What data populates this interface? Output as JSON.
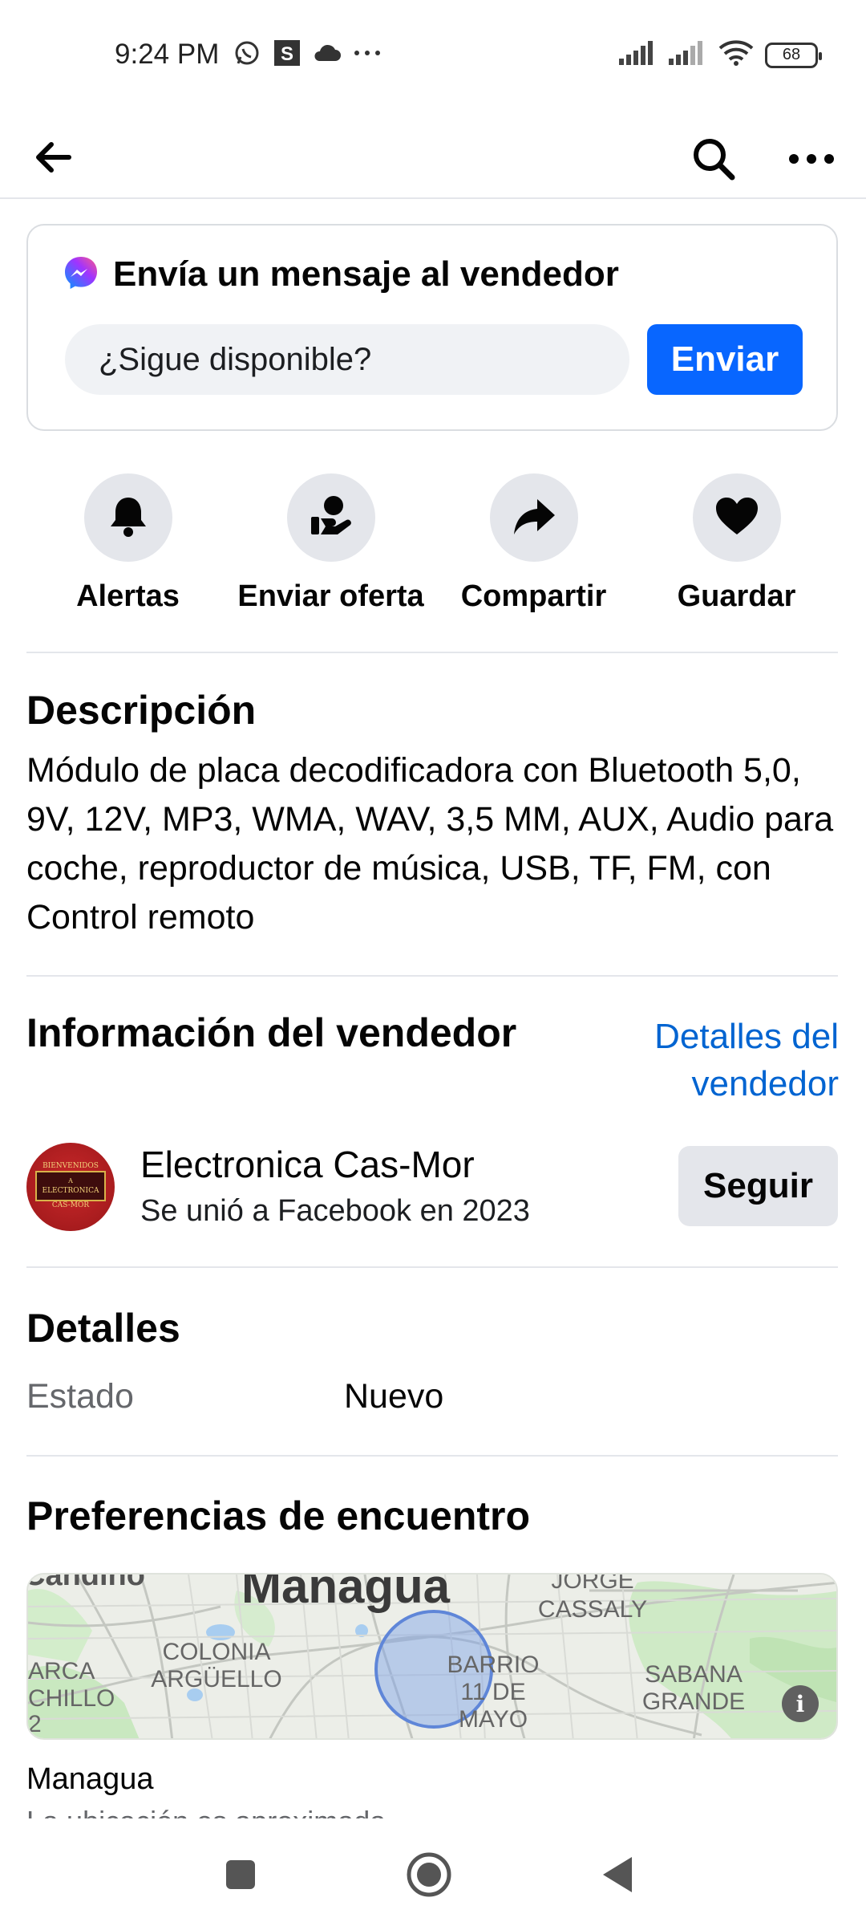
{
  "status_bar": {
    "time": "9:24 PM",
    "battery": "68",
    "left_icons": [
      "whatsapp-icon",
      "s-app-icon",
      "cloud-icon",
      "more-dots-icon"
    ],
    "right_icons": [
      "signal-icon",
      "signal-icon",
      "wifi-icon",
      "battery-icon"
    ]
  },
  "app_bar": {
    "icons": [
      "back-arrow-icon",
      "search-icon",
      "more-options-icon"
    ]
  },
  "message": {
    "title": "Envía un mensaje al vendedor",
    "input_value": "¿Sigue disponible?",
    "send_label": "Enviar",
    "accent": "#0866ff"
  },
  "actions": [
    {
      "label": "Alertas",
      "icon": "bell-icon"
    },
    {
      "label": "Enviar oferta",
      "icon": "offer-hand-icon"
    },
    {
      "label": "Compartir",
      "icon": "share-icon"
    },
    {
      "label": "Guardar",
      "icon": "heart-icon"
    }
  ],
  "description": {
    "title": "Descripción",
    "text": "Módulo de placa decodificadora con Bluetooth 5,0, 9V, 12V, MP3, WMA, WAV, 3,5 MM, AUX, Audio para coche, reproductor de música, USB, TF, FM, con Control remoto"
  },
  "seller": {
    "section_title": "Información del vendedor",
    "details_link": "Detalles del vendedor",
    "name": "Electronica Cas-Mor",
    "joined": "Se unió a Facebook en 2023",
    "follow_label": "Seguir",
    "avatar_text": "BIENVENIDOS A ELECTRONICA CAS-MOR"
  },
  "details": {
    "title": "Detalles",
    "rows": [
      {
        "label": "Estado",
        "value": "Nuevo"
      }
    ]
  },
  "meetup": {
    "title": "Preferencias de encuentro",
    "map_labels": {
      "city": "Managua",
      "colonia": "COLONIA ARGÜELLO",
      "jorge": "JORGE CASSALY",
      "barrio": "BARRIO 11 DE MAYO",
      "sabana": "SABANA GRANDE",
      "left1": "ARCA",
      "left2": "CHILLO",
      "left3": "2",
      "top_left": "Candino"
    },
    "location": "Managua",
    "note": "La ubicación es aproximada"
  },
  "nav_bar": {
    "icons": [
      "recents-square-icon",
      "home-circle-icon",
      "back-triangle-icon"
    ]
  }
}
